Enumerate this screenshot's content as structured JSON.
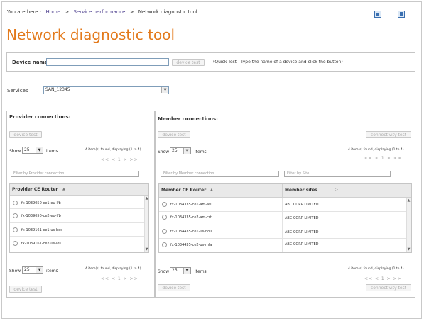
{
  "breadcrumb": {
    "prefix": "You are here :",
    "home": "Home",
    "sep1": ">",
    "service_performance": "Service performance",
    "sep2": ">",
    "current": "Network diagnostic tool"
  },
  "page_title": "Network diagnostic tool",
  "device": {
    "label": "Device name",
    "value": "",
    "button": "device test",
    "hint": "(Quick Test - Type the name of a device and click the button)"
  },
  "services": {
    "label": "Services",
    "selected": "SAN_12345"
  },
  "provider": {
    "title": "Provider connections:",
    "button_top": "device test",
    "show_label": "Show",
    "page_size": "25",
    "items_label": "items",
    "found_text": "4 item(s) found, displaying (1 to 4)",
    "pagination": "<< < 1 > >>",
    "filter_placeholder": "Filter by Provider connection",
    "column_header": "Provider CE Router",
    "sort_glyph": "▲",
    "rows": [
      "fx-1039050-ce1-eu-lfb",
      "fx-1039050-ce2-eu-lfb",
      "fx-1039161-ce1-us-bos",
      "fx-1039161-ce2-us-los"
    ],
    "show_label_bottom": "Show",
    "page_size_bottom": "25",
    "items_label_bottom": "items",
    "found_text_bottom": "4 item(s) found, displaying (1 to 4)",
    "pagination_bottom": "<< < 1 > >>",
    "button_bottom": "device test"
  },
  "member": {
    "title": "Member connections:",
    "button_device": "device test",
    "button_connectivity": "connectivity test",
    "show_label": "Show",
    "page_size": "25",
    "items_label": "items",
    "found_text": "4 item(s) found, displaying (1 to 4)",
    "pagination": "<< < 1 > >>",
    "filter_router_placeholder": "Filter by Member connection",
    "filter_site_placeholder": "Filter by Site",
    "col_router": "Member CE Router",
    "col_site": "Member sites",
    "sort_glyph_router": "▲",
    "sort_glyph_site": "◇",
    "rows": [
      {
        "router": "fx-1034335-ce1-am-atl",
        "site": "ABC CORP LIMITED"
      },
      {
        "router": "fx-1034335-ce2-am-crt",
        "site": "ABC CORP LIMITED"
      },
      {
        "router": "fx-1034435-ce1-us-hou",
        "site": "ABC CORP LIMITED"
      },
      {
        "router": "fx-1034435-ce2-us-mla",
        "site": "ABC CORP LIMITED"
      }
    ],
    "show_label_bottom": "Show",
    "page_size_bottom": "25",
    "items_label_bottom": "items",
    "found_text_bottom": "4 item(s) found, displaying (1 to 4)",
    "pagination_bottom": "<< < 1 > >>",
    "button_device_bottom": "device test",
    "button_connectivity_bottom": "connectivity test"
  },
  "colors": {
    "title_orange": "#e37a1c",
    "breadcrumb_link": "#4a3c8c"
  },
  "icons": [
    "export-icon",
    "print-icon"
  ]
}
